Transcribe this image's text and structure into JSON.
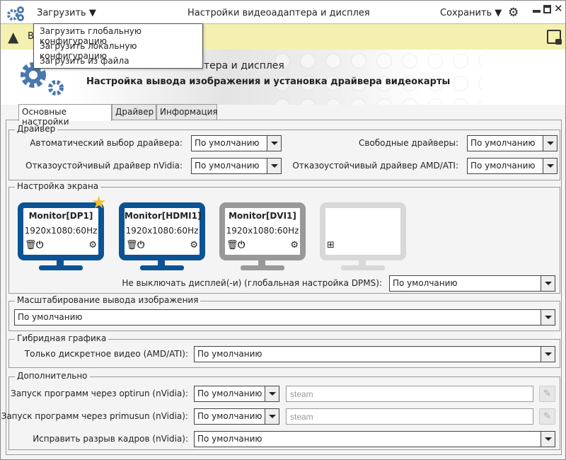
{
  "window": {
    "title": "Настройки видеоадаптера и дисплея",
    "load_label": "Загрузить",
    "save_label": "Сохранить"
  },
  "load_menu": [
    "Загрузить глобальную конфигурацию",
    "Загрузить локальную конфигурацию",
    "Загрузить из файла"
  ],
  "warning": {
    "text": "В"
  },
  "header": {
    "title": "Настройки видеоадаптера и дисплея",
    "visible_title": "тера и дисплея",
    "subtitle": "Настройка вывода изображения и установка драйвера видеокарты"
  },
  "tabs": [
    "Основные настройки",
    "Драйвер",
    "Информация"
  ],
  "driver": {
    "legend": "Драйвер",
    "auto_label": "Автоматический выбор драйвера:",
    "auto_value": "По умолчанию",
    "free_label": "Свободные драйверы:",
    "free_value": "По умолчанию",
    "nvidia_label": "Отказоустойчивый драйвер nVidia:",
    "nvidia_value": "По умолчанию",
    "amd_label": "Отказоустойчивый драйвер AMD/ATI:",
    "amd_value": "По умолчанию"
  },
  "screen": {
    "legend": "Настройка экрана",
    "monitors": [
      {
        "name": "Monitor[DP1]",
        "res": "1920x1080:60Hz",
        "primary": true
      },
      {
        "name": "Monitor[HDMI1]",
        "res": "1920x1080:60Hz"
      },
      {
        "name": "Monitor[DVI1]",
        "res": "1920x1080:60Hz",
        "disabled": true
      }
    ],
    "dpms_label": "Не выключать дисплей(-и) (глобальная настройка DPMS):",
    "dpms_value": "По умолчанию"
  },
  "scaling": {
    "legend": "Масштабирование вывода изображения",
    "value": "По умолчанию"
  },
  "hybrid": {
    "legend": "Гибридная графика",
    "label": "Только дискретное видео (AMD/ATI):",
    "value": "По умолчанию"
  },
  "extra": {
    "legend": "Дополнительно",
    "optirun_label": "Запуск программ через optirun (nVidia):",
    "optirun_value": "По умолчанию",
    "optirun_placeholder": "steam",
    "primusun_label": "Запуск программ через primusun (nVidia):",
    "primusun_value": "По умолчанию",
    "primusun_placeholder": "steam",
    "tearing_label": "Исправить разрыв кадров (nVidia):",
    "tearing_value": "По умолчанию"
  },
  "colors": {
    "accent": "#0b5394",
    "disabled": "#999999",
    "placeholder_monitor": "#d8d8d8",
    "warning_bg": "#f4f0b0",
    "gear": "#4a78ad",
    "star": "#f2c12e"
  }
}
